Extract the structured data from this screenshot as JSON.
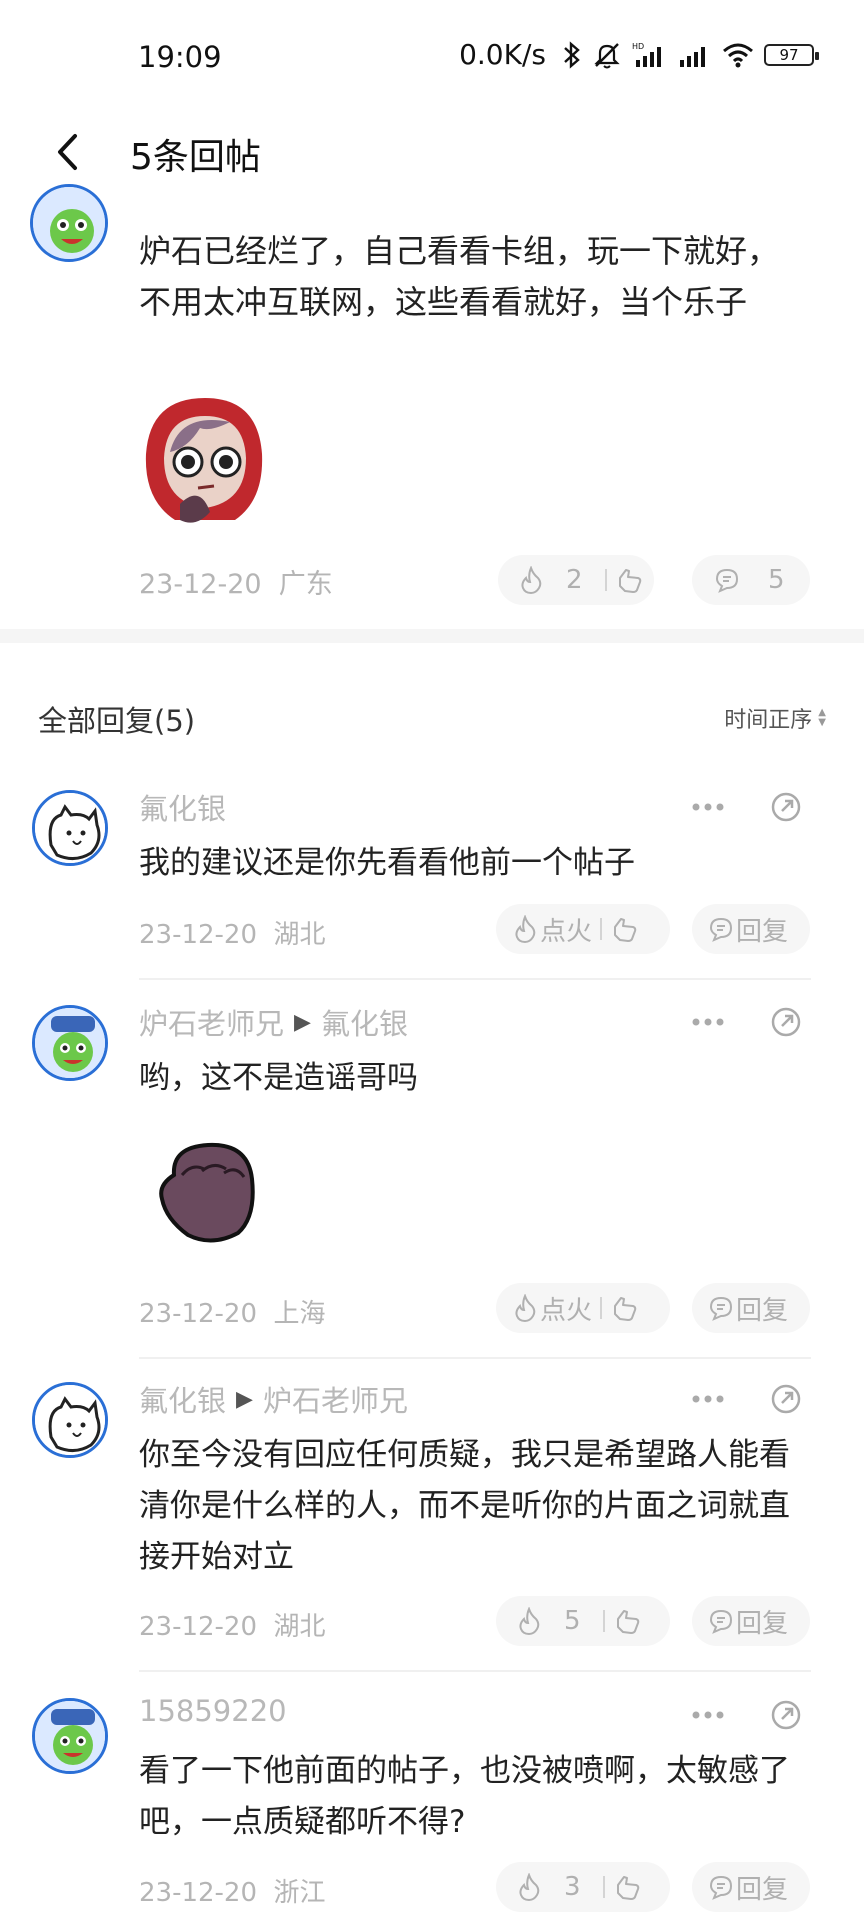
{
  "status_bar": {
    "time": "19:09",
    "net_speed": "0.0K/s",
    "battery": "97"
  },
  "app_bar": {
    "title": "5条回帖"
  },
  "post": {
    "text": "炉石已经烂了，自己看看卡组，玩一下就好，不用太冲互联网，这些看看就好，当个乐子",
    "date": "23-12-20",
    "location": "广东",
    "likes": "2",
    "comments": "5"
  },
  "section": {
    "title": "全部回复(5)",
    "sort_label": "时间正序"
  },
  "replies": [
    {
      "author": "氟化银",
      "target": "",
      "text": "我的建议还是你先看看他前一个帖子",
      "date": "23-12-20",
      "location": "湖北",
      "like_label": "点火",
      "reply_label": "回复"
    },
    {
      "author": "炉石老师兄",
      "target": "氟化银",
      "text": "哟，这不是造谣哥吗",
      "date": "23-12-20",
      "location": "上海",
      "like_label": "点火",
      "reply_label": "回复"
    },
    {
      "author": "氟化银",
      "target": "炉石老师兄",
      "text": "你至今没有回应任何质疑，我只是希望路人能看清你是什么样的人，而不是听你的片面之词就直接开始对立",
      "date": "23-12-20",
      "location": "湖北",
      "like_label": "5",
      "reply_label": "回复"
    },
    {
      "author": "15859220",
      "target": "",
      "text": "看了一下他前面的帖子，也没被喷啊，太敏感了吧，一点质疑都听不得?",
      "date": "23-12-20",
      "location": "浙江",
      "like_label": "3",
      "reply_label": "回复"
    }
  ],
  "colors": {
    "accent_blue": "#2a6fd6",
    "muted_text": "#b5b5b5",
    "pill_bg": "#f6f6f6"
  },
  "icons": [
    "back-arrow",
    "flame",
    "thumb-down",
    "comment",
    "more-dots",
    "share"
  ]
}
